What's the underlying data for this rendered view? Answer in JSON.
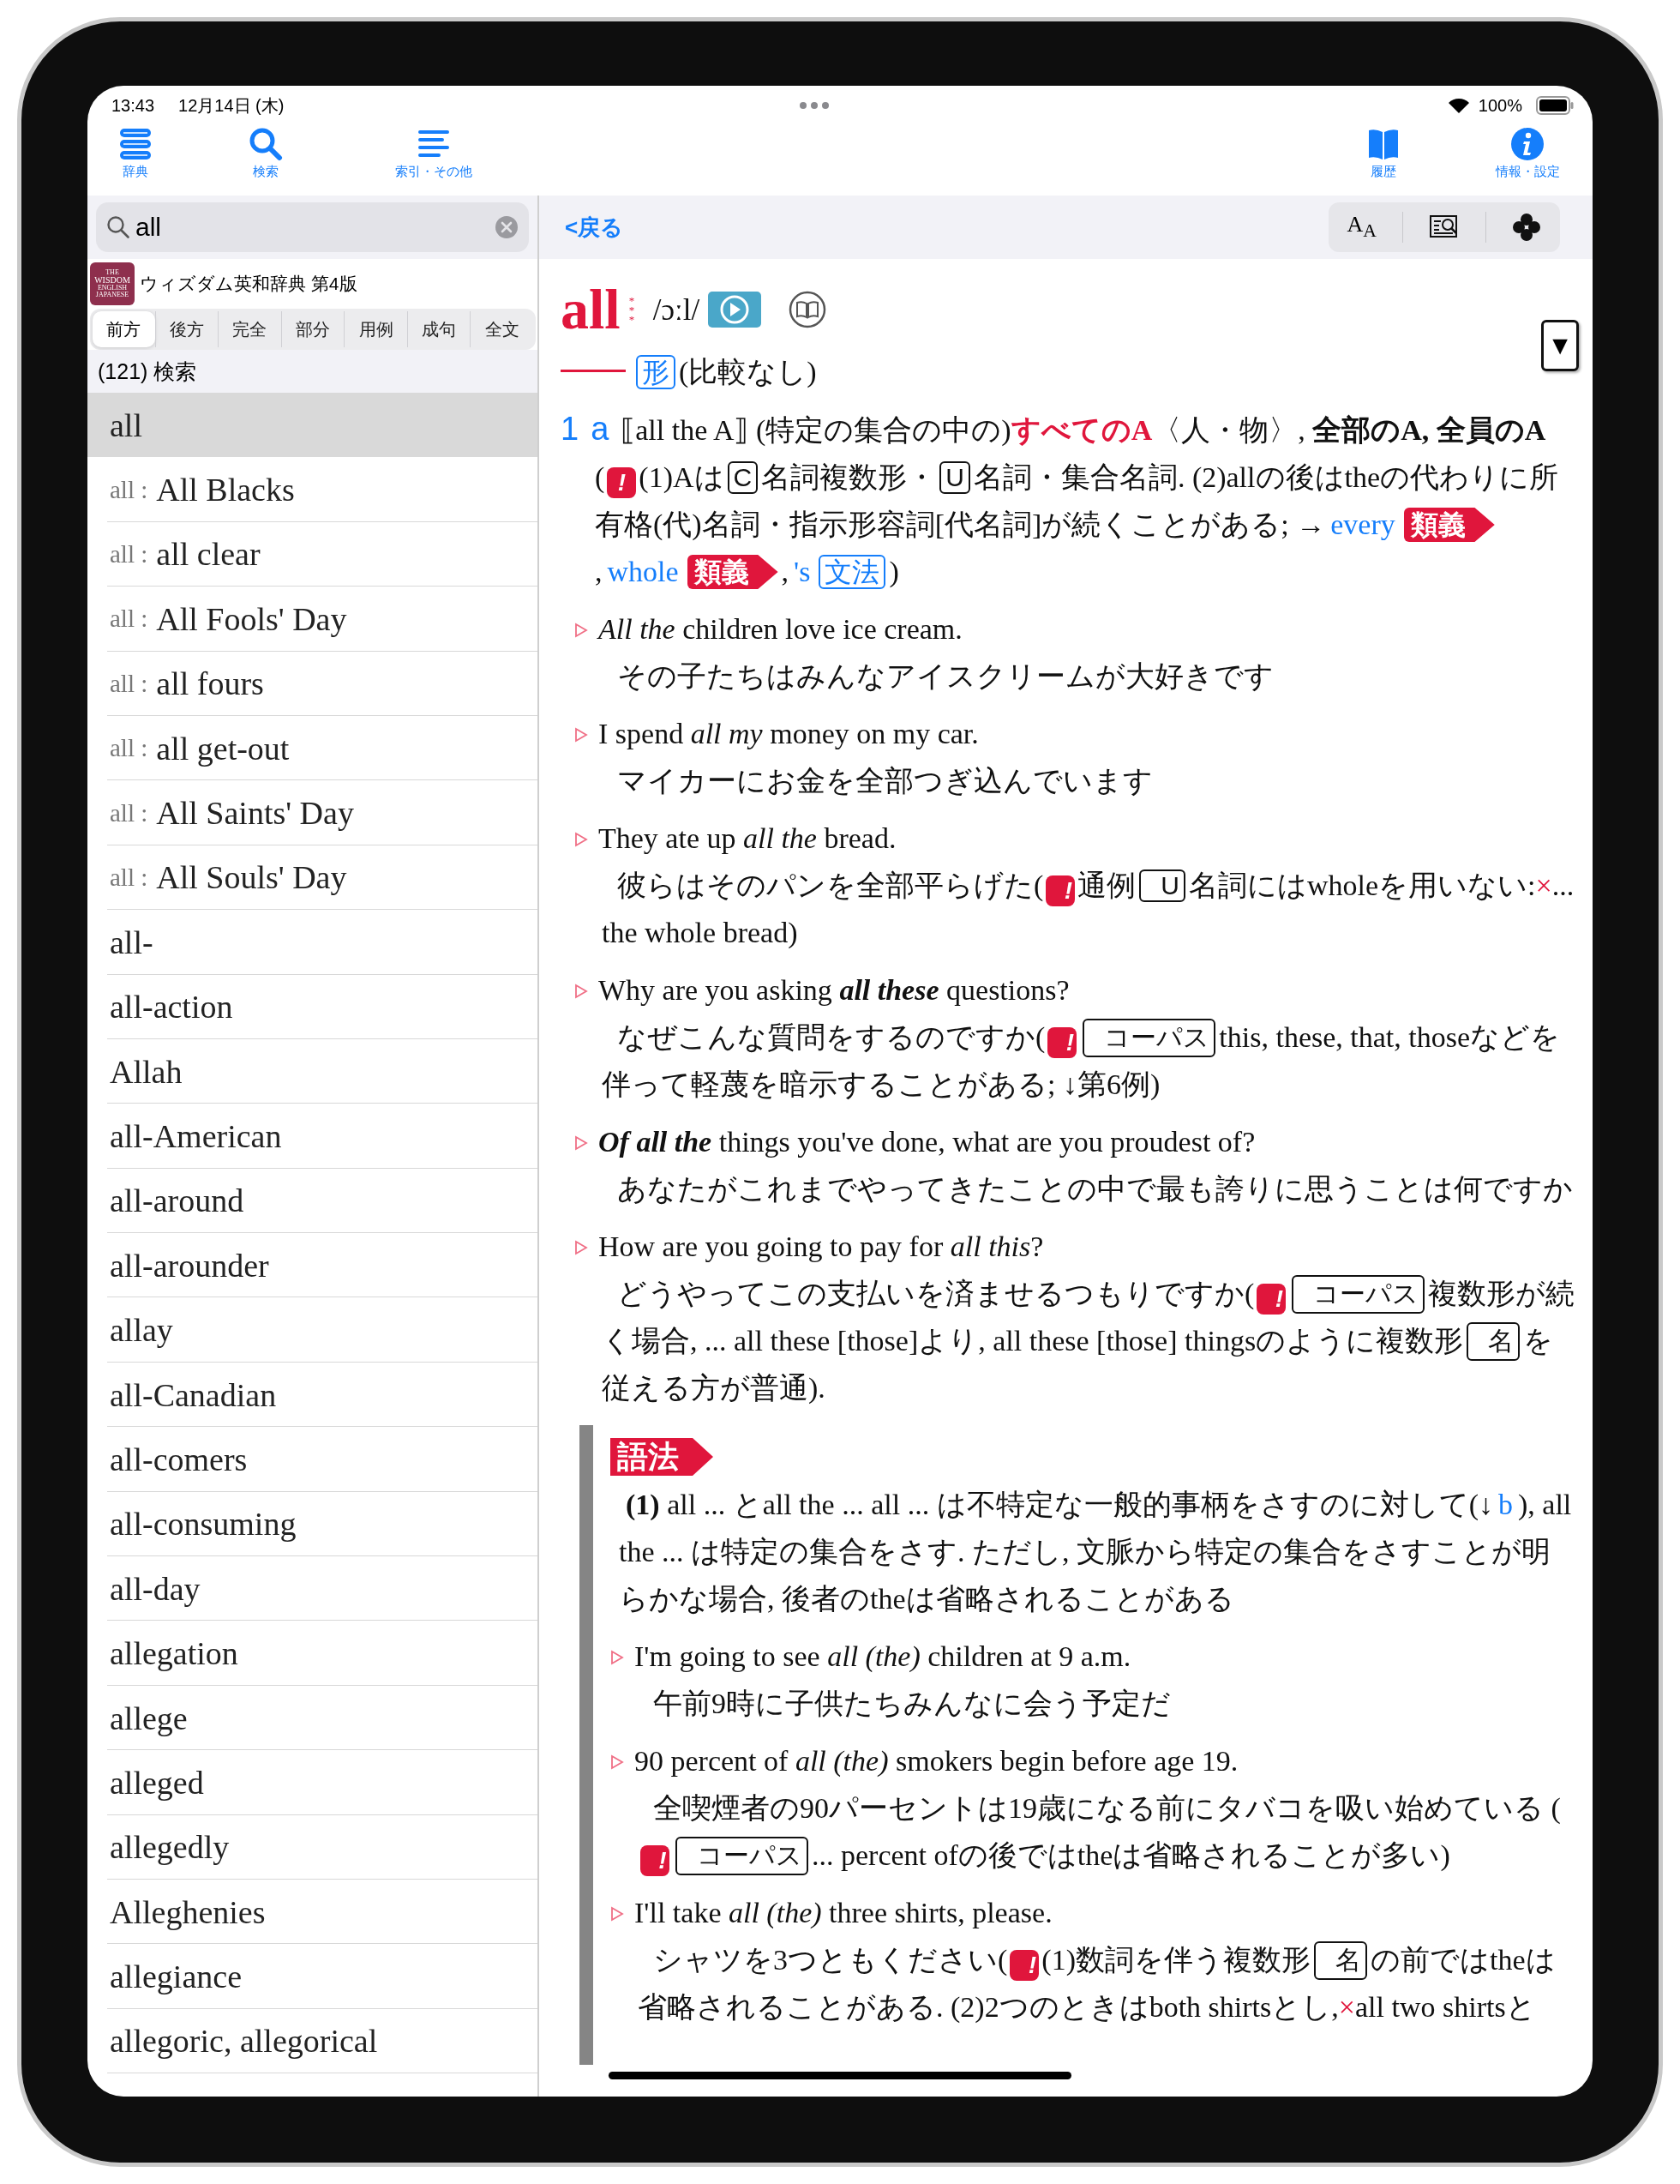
{
  "status_bar": {
    "time": "13:43",
    "date": "12月14日 (木)",
    "battery": "100%"
  },
  "toolbar": {
    "left": [
      {
        "label": "辞典",
        "kind": "books"
      },
      {
        "label": "検索",
        "kind": "search"
      },
      {
        "label": "索引・その他",
        "kind": "list"
      }
    ],
    "right": [
      {
        "label": "履歴",
        "kind": "book"
      },
      {
        "label": "情報・設定",
        "kind": "info"
      }
    ]
  },
  "search": {
    "value": "all"
  },
  "dictionary": {
    "logo_lines": [
      "THE",
      "WISDOM",
      "ENGLISH",
      "JAPANESE"
    ],
    "title": "ウィズダム英和辞典 第4版"
  },
  "search_modes": [
    {
      "label": "前方",
      "selected": true
    },
    {
      "label": "後方",
      "selected": false
    },
    {
      "label": "完全",
      "selected": false
    },
    {
      "label": "部分",
      "selected": false
    },
    {
      "label": "用例",
      "selected": false
    },
    {
      "label": "成句",
      "selected": false
    },
    {
      "label": "全文",
      "selected": false
    }
  ],
  "result_count": "(121) 検索",
  "results": [
    {
      "headword": "all",
      "selected": true
    },
    {
      "prefix": "all :",
      "headword": "All Blacks",
      "selected": false
    },
    {
      "prefix": "all :",
      "headword": "all clear",
      "selected": false
    },
    {
      "prefix": "all :",
      "headword": "All Fools' Day",
      "selected": false
    },
    {
      "prefix": "all :",
      "headword": "all fours",
      "selected": false
    },
    {
      "prefix": "all :",
      "headword": "all get-out",
      "selected": false
    },
    {
      "prefix": "all :",
      "headword": "All Saints' Day",
      "selected": false
    },
    {
      "prefix": "all :",
      "headword": "All Souls' Day",
      "selected": false
    },
    {
      "headword": "all-",
      "selected": false
    },
    {
      "headword": "all-action",
      "selected": false
    },
    {
      "headword": "Allah",
      "selected": false
    },
    {
      "headword": "all-American",
      "selected": false
    },
    {
      "headword": "all-around",
      "selected": false
    },
    {
      "headword": "all-arounder",
      "selected": false
    },
    {
      "headword": "allay",
      "selected": false
    },
    {
      "headword": "all-Canadian",
      "selected": false
    },
    {
      "headword": "all-comers",
      "selected": false
    },
    {
      "headword": "all-consuming",
      "selected": false
    },
    {
      "headword": "all-day",
      "selected": false
    },
    {
      "headword": "allegation",
      "selected": false
    },
    {
      "headword": "allege",
      "selected": false
    },
    {
      "headword": "alleged",
      "selected": false
    },
    {
      "headword": "allegedly",
      "selected": false
    },
    {
      "headword": "Alleghenies",
      "selected": false
    },
    {
      "headword": "allegiance",
      "selected": false
    },
    {
      "headword": "allegoric, allegorical",
      "selected": false
    }
  ],
  "back": "<戻る",
  "font_button": "A$_{A}$",
  "entry": {
    "headword": "all",
    "frequency": "***",
    "pronunciation": "/ɔːl/",
    "collapse_button": "▼",
    "pos_line": [
      {
        "kind": "bluebox",
        "text": "形"
      },
      {
        "kind": "text",
        "text": "(比較なし)"
      }
    ],
    "senses": [
      {
        "number": "1",
        "letter": "a",
        "definition": [
          {
            "kind": "text",
            "text": "⟦all the A⟧ (特定の集合の中の)"
          },
          {
            "kind": "red",
            "text": "すべてのA"
          },
          {
            "kind": "text",
            "text": "〈人・物〉, **全部のA, 全員のA**"
          }
        ],
        "note": [
          {
            "kind": "text",
            "text": "("
          },
          {
            "kind": "badge",
            "text": "!"
          },
          {
            "kind": "text",
            "text": "(1)Aは"
          },
          {
            "kind": "box",
            "text": "C"
          },
          {
            "kind": "text",
            "text": "名詞複数形・"
          },
          {
            "kind": "box",
            "text": "U"
          },
          {
            "kind": "text",
            "text": "名詞・集合名詞. (2)allの後はtheの代わりに所有格(代)名詞・指示形容詞[代名詞]が続くことがある; →"
          },
          {
            "kind": "link",
            "text": "every"
          },
          {
            "kind": "tag",
            "text": "類義"
          },
          {
            "kind": "text",
            "text": ","
          },
          {
            "kind": "link",
            "text": "whole"
          },
          {
            "kind": "tag",
            "text": "類義"
          },
          {
            "kind": "text",
            "text": ","
          },
          {
            "kind": "link",
            "text": "'s"
          },
          {
            "kind": "bluebox",
            "text": "文法"
          },
          {
            "kind": "text",
            "text": ")"
          }
        ],
        "examples": [
          {
            "english": "*All the* children love ice cream.",
            "japanese": [
              {
                "kind": "text",
                "text": "その子たちはみんなアイスクリームが大好きです"
              }
            ]
          },
          {
            "english": "I spend *all my* money on my car.",
            "japanese": [
              {
                "kind": "text",
                "text": "マイカーにお金を全部つぎ込んでいます"
              }
            ]
          },
          {
            "english": "They ate up *all the* bread.",
            "japanese": [
              {
                "kind": "text",
                "text": "彼らはそのパンを全部平らげた("
              },
              {
                "kind": "badge",
                "text": "!"
              },
              {
                "kind": "text",
                "text": "通例"
              },
              {
                "kind": "box",
                "text": "U"
              },
              {
                "kind": "text",
                "text": "名詞にはwholeを用いない:"
              },
              {
                "kind": "cross",
                "text": "×"
              },
              {
                "kind": "text",
                "text": "... the whole bread)"
              }
            ]
          },
          {
            "english": [
              {
                "kind": "text",
                "text": "Why are you asking "
              },
              {
                "kind": "emph",
                "text": "all these"
              },
              {
                "kind": "text",
                "text": " questions?"
              }
            ],
            "japanese": [
              {
                "kind": "text",
                "text": "なぜこんな質問をするのですか("
              },
              {
                "kind": "badge",
                "text": "!"
              },
              {
                "kind": "box",
                "text": "コーパス"
              },
              {
                "kind": "text",
                "text": "this, these, that, thoseなどを伴って軽蔑を暗示することがある; ↓第6例)"
              }
            ]
          },
          {
            "english": [
              {
                "kind": "emph",
                "text": "Of all the"
              },
              {
                "kind": "text",
                "text": " things you've done, what are you proudest of?"
              }
            ],
            "japanese": [
              {
                "kind": "text",
                "text": "あなたがこれまでやってきたことの中で最も誇りに思うことは何ですか"
              }
            ]
          },
          {
            "english": "How are you going to pay for *all this*?",
            "japanese": [
              {
                "kind": "text",
                "text": "どうやってこの支払いを済ませるつもりですか("
              },
              {
                "kind": "badge",
                "text": "!"
              },
              {
                "kind": "box",
                "text": "コーパス"
              },
              {
                "kind": "text",
                "text": "複数形が続く場合, ... all these [those]より, all these [those] thingsのように複数形"
              },
              {
                "kind": "box",
                "text": "名"
              },
              {
                "kind": "text",
                "text": "を従える方が普通)."
              }
            ]
          }
        ]
      }
    ],
    "usage_note": {
      "label": "語法",
      "paragraph": [
        {
          "kind": "text",
          "text": "**(1)** all ... とall the ... all ... は不特定な一般的事柄をさすのに対して(↓"
        },
        {
          "kind": "link",
          "text": "b"
        },
        {
          "kind": "text",
          "text": "), all the ... は特定の集合をさす. ただし, 文脈から特定の集合をさすことが明らかな場合, 後者のtheは省略されることがある"
        }
      ],
      "examples": [
        {
          "english": "I'm going to see *all (the)* children at 9 a.m.",
          "japanese": [
            {
              "kind": "text",
              "text": "午前9時に子供たちみんなに会う予定だ"
            }
          ]
        },
        {
          "english": "90 percent of *all (the)* smokers begin before age 19.",
          "japanese": [
            {
              "kind": "text",
              "text": "全喫煙者の90パーセントは19歳になる前にタバコを吸い始めている ("
            },
            {
              "kind": "badge",
              "text": "!"
            },
            {
              "kind": "box",
              "text": "コーパス"
            },
            {
              "kind": "text",
              "text": "... percent ofの後ではtheは省略されることが多い)"
            }
          ]
        },
        {
          "english": "I'll take *all (the)* three shirts, please.",
          "japanese": [
            {
              "kind": "text",
              "text": "シャツを3つともください("
            },
            {
              "kind": "badge",
              "text": "!"
            },
            {
              "kind": "text",
              "text": "(1)数詞を伴う複数形"
            },
            {
              "kind": "box",
              "text": "名"
            },
            {
              "kind": "text",
              "text": "の前ではtheは省略されることがある. (2)2つのときはboth shirtsとし,"
            },
            {
              "kind": "cross",
              "text": "×"
            },
            {
              "kind": "text",
              "text": "all two shirtsと"
            }
          ]
        }
      ]
    }
  }
}
